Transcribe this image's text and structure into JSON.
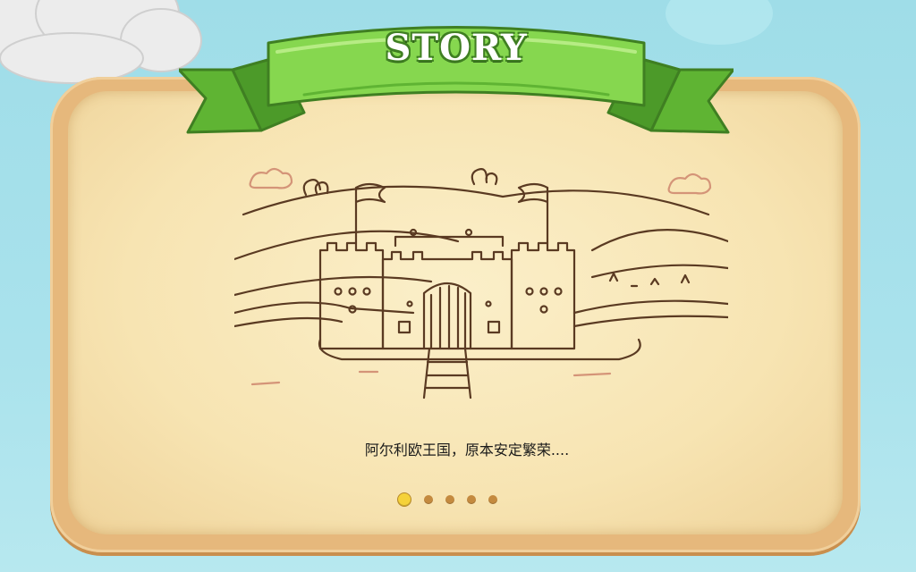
{
  "banner": {
    "title": "STORY"
  },
  "story": {
    "caption": "阿尔利欧王国，原本安定繁荣....",
    "page_count": 5,
    "current_page": 1
  },
  "colors": {
    "banner_green": "#7fd04a",
    "board_frame": "#e6b87c",
    "paper": "#f7e4b2",
    "ink": "#5a3a22",
    "dot_active": "#f5d23a",
    "dot_inactive": "#c48a3f"
  },
  "icons": {
    "illustration": "castle-drawing",
    "cloud": "cloud-icon"
  }
}
